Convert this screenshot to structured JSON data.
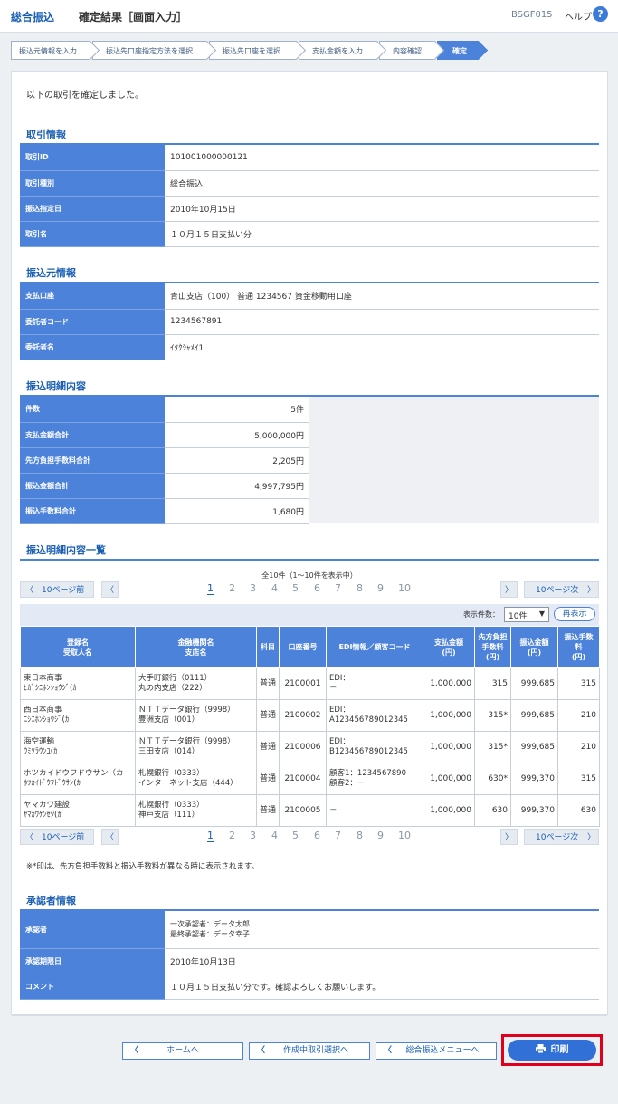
{
  "header": {
    "section": "総合振込",
    "title": "確定結果［画面入力］",
    "screen_id": "BSGF015",
    "help": "ヘルプ",
    "help_icon": "?"
  },
  "steps": [
    "振込元情報を入力",
    "振込先口座指定方法を選択",
    "振込先口座を選択",
    "支払金額を入力",
    "内容確認",
    "確定"
  ],
  "message": "以下の取引を確定しました。",
  "sections": {
    "torihiki": "取引情報",
    "furikomimoto": "振込元情報",
    "meisai": "振込明細内容",
    "ichiran": "振込明細内容一覧",
    "shoninsha": "承認者情報"
  },
  "torihiki": [
    {
      "k": "取引ID",
      "v": "101001000000121"
    },
    {
      "k": "取引種別",
      "v": "総合振込"
    },
    {
      "k": "振込指定日",
      "v": "2010年10月15日"
    },
    {
      "k": "取引名",
      "v": "１０月１５日支払い分"
    }
  ],
  "furikomimoto": [
    {
      "k": "支払口座",
      "v": "青山支店（100） 普通 1234567 資金移動用口座"
    },
    {
      "k": "委託者コード",
      "v": "1234567891"
    },
    {
      "k": "委託者名",
      "v": "ｲﾀｸｼｬﾒｲ1"
    }
  ],
  "meisai": [
    {
      "k": "件数",
      "v": "5件"
    },
    {
      "k": "支払金額合計",
      "v": "5,000,000円"
    },
    {
      "k": "先方負担手数料合計",
      "v": "2,205円"
    },
    {
      "k": "振込金額合計",
      "v": "4,997,795円"
    },
    {
      "k": "振込手数料合計",
      "v": "1,680円"
    }
  ],
  "pager": {
    "prev10": "10ページ前",
    "next10": "10ページ次",
    "pages": [
      "1",
      "2",
      "3",
      "4",
      "5",
      "6",
      "7",
      "8",
      "9",
      "10"
    ],
    "prev_icon": "chevron-left",
    "next_icon": "chevron-right"
  },
  "count_text": "全10件（1〜10件を表示中）",
  "display": {
    "label": "表示件数：",
    "value": "10件",
    "refresh": "再表示"
  },
  "table": {
    "headers": [
      "登録名\n受取人名",
      "金融機関名\n支店名",
      "科目",
      "口座番号",
      "EDI情報／顧客コード",
      "支払金額\n(円)",
      "先方負担\n手数料\n(円)",
      "振込金額\n(円)",
      "振込手数\n料\n(円)"
    ],
    "rows": [
      [
        "東日本商事\nﾋｶﾞｼﾆﾎﾝｼｮｳｼﾞ(ｶ",
        "大手町銀行（0111）\n丸の内支店（222）",
        "普通",
        "2100001",
        "EDI：\n－",
        "1,000,000",
        "315",
        "999,685",
        "315"
      ],
      [
        "西日本商事\nﾆｼﾆﾎﾝｼｮｳｼﾞ(ｶ",
        "ＮＴＴデータ銀行（9998）\n豊洲支店（001）",
        "普通",
        "2100002",
        "EDI：\nA123456789012345",
        "1,000,000",
        "315*",
        "999,685",
        "210"
      ],
      [
        "海空運輸\nｳﾐｿﾗｳﾝﾕ(ｶ",
        "ＮＴＴデータ銀行（9998）\n三田支店（014）",
        "普通",
        "2100006",
        "EDI：\nB123456789012345",
        "1,000,000",
        "315*",
        "999,685",
        "210"
      ],
      [
        "ホツカイドウフドウサン（カ\nﾎﾂｶｲﾄﾞｳﾌﾄﾞｳｻﾝ(ｶ",
        "札幌銀行（0333）\nインターネット支店（444）",
        "普通",
        "2100004",
        "顧客1：1234567890\n顧客2：－",
        "1,000,000",
        "630*",
        "999,370",
        "315"
      ],
      [
        "ヤマカワ建設\nﾔﾏｶﾜｹﾝｾﾂ(ｶ",
        "札幌銀行（0333）\n神戸支店（111）",
        "普通",
        "2100005",
        "－",
        "1,000,000",
        "630",
        "999,370",
        "630"
      ]
    ]
  },
  "note": "※*印は、先方負担手数料と振込手数料が異なる時に表示されます。",
  "shoninsha": [
    {
      "k": "承認者",
      "v": "一次承認者：データ太郎\n最終承認者：データ幸子"
    },
    {
      "k": "承認期限日",
      "v": "2010年10月13日"
    },
    {
      "k": "コメント",
      "v": "１０月１５日支払い分です。確認よろしくお願いします。"
    }
  ],
  "buttons": {
    "home": "ホームへ",
    "sakusei": "作成中取引選択へ",
    "menu": "総合振込メニューへ",
    "print": "印刷",
    "print_icon": "printer"
  },
  "colors": {
    "accent": "#4c82d9",
    "link": "#1a5fb4",
    "highlight": "#e0001b"
  }
}
